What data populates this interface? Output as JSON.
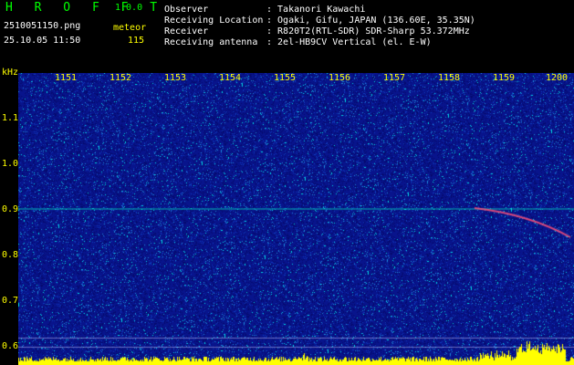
{
  "header": {
    "app_name": "H R O F F T",
    "version": "1.0.0",
    "filename": "2510051150.png",
    "datetime": "25.10.05 11:50",
    "meteor_label": "meteor",
    "meteor_count": "115"
  },
  "info": {
    "labels": [
      "Observer",
      "Receiving Location",
      "Receiver",
      "Receiving antenna"
    ],
    "values": [
      ": Takanori Kawachi",
      ": Ogaki, Gifu, JAPAN (136.60E, 35.35N)",
      ": R820T2(RTL-SDR) SDR-Sharp 53.372MHz",
      ": 2el-HB9CV Vertical (el. E-W)"
    ]
  },
  "axes": {
    "y_unit": "kHz",
    "x_ticks": [
      "1151",
      "1152",
      "1153",
      "1154",
      "1155",
      "1156",
      "1157",
      "1158",
      "1159",
      "1200"
    ],
    "y_ticks": [
      "1.1",
      "1.0",
      "0.9",
      "0.8",
      "0.7",
      "0.6"
    ]
  },
  "colors": {
    "background": "#000000",
    "label_yellow": "#ffff00",
    "title_green": "#00ff00",
    "spectrogram_base": "#0b1a9c",
    "signal_cyan": "#00ffff"
  }
}
